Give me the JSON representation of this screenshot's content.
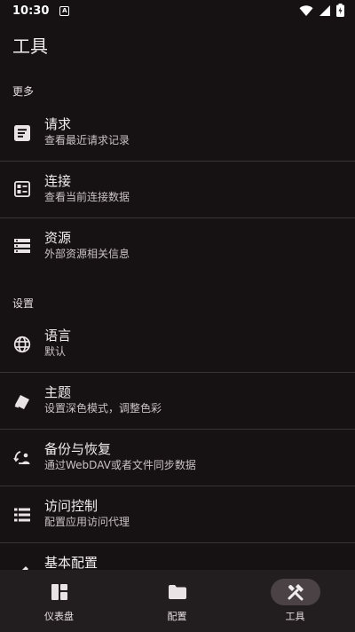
{
  "status": {
    "time": "10:30",
    "notification_badge": "A"
  },
  "page": {
    "title": "工具"
  },
  "sections": {
    "more": "更多",
    "settings": "设置"
  },
  "items": {
    "requests": {
      "title": "请求",
      "subtitle": "查看最近请求记录",
      "icon": "request-list-icon"
    },
    "connections": {
      "title": "连接",
      "subtitle": "查看当前连接数据",
      "icon": "connections-icon"
    },
    "resources": {
      "title": "资源",
      "subtitle": "外部资源相关信息",
      "icon": "resources-icon"
    },
    "language": {
      "title": "语言",
      "subtitle": "默认",
      "icon": "globe-icon"
    },
    "theme": {
      "title": "主题",
      "subtitle": "设置深色模式，调整色彩",
      "icon": "palette-icon"
    },
    "backup": {
      "title": "备份与恢复",
      "subtitle": "通过WebDAV或者文件同步数据",
      "icon": "backup-restore-icon"
    },
    "access": {
      "title": "访问控制",
      "subtitle": "配置应用访问代理",
      "icon": "access-list-icon"
    },
    "basic": {
      "title": "基本配置",
      "icon": "edit-icon"
    }
  },
  "nav": {
    "dashboard": "仪表盘",
    "config": "配置",
    "tools": "工具",
    "active": "tools"
  },
  "colors": {
    "background": "#161214",
    "nav_background": "#221d1f",
    "active_pill": "#4a4244"
  }
}
